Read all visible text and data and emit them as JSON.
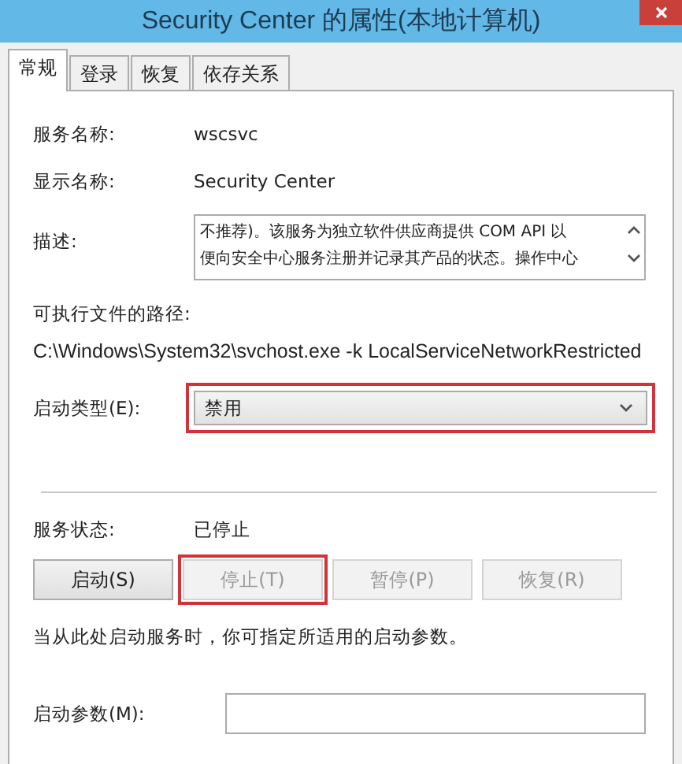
{
  "window": {
    "title": "Security Center 的属性(本地计算机)"
  },
  "tabs": [
    {
      "label": "常规",
      "selected": true
    },
    {
      "label": "登录",
      "selected": false
    },
    {
      "label": "恢复",
      "selected": false
    },
    {
      "label": "依存关系",
      "selected": false
    }
  ],
  "service_name": {
    "label": "服务名称:",
    "value": "wscsvc"
  },
  "display_name": {
    "label": "显示名称:",
    "value": "Security Center"
  },
  "description": {
    "label": "描述:",
    "lines": [
      "不推荐)。该服务为独立软件供应商提供 COM API 以",
      "便向安全中心服务注册并记录其产品的状态。操作中心"
    ]
  },
  "executable_path": {
    "label": "可执行文件的路径:",
    "value": "C:\\Windows\\System32\\svchost.exe -k LocalServiceNetworkRestricted"
  },
  "startup_type": {
    "label": "启动类型(E):",
    "value": "禁用",
    "highlighted": true
  },
  "service_status": {
    "label": "服务状态:",
    "value": "已停止"
  },
  "buttons": [
    {
      "label": "启动(S)",
      "disabled": false,
      "highlighted": false
    },
    {
      "label": "停止(T)",
      "disabled": true,
      "highlighted": true
    },
    {
      "label": "暂停(P)",
      "disabled": true,
      "highlighted": false
    },
    {
      "label": "恢复(R)",
      "disabled": true,
      "highlighted": false
    }
  ],
  "hint": "当从此处启动服务时，你可指定所适用的启动参数。",
  "start_parameters": {
    "label": "启动参数(M):"
  }
}
